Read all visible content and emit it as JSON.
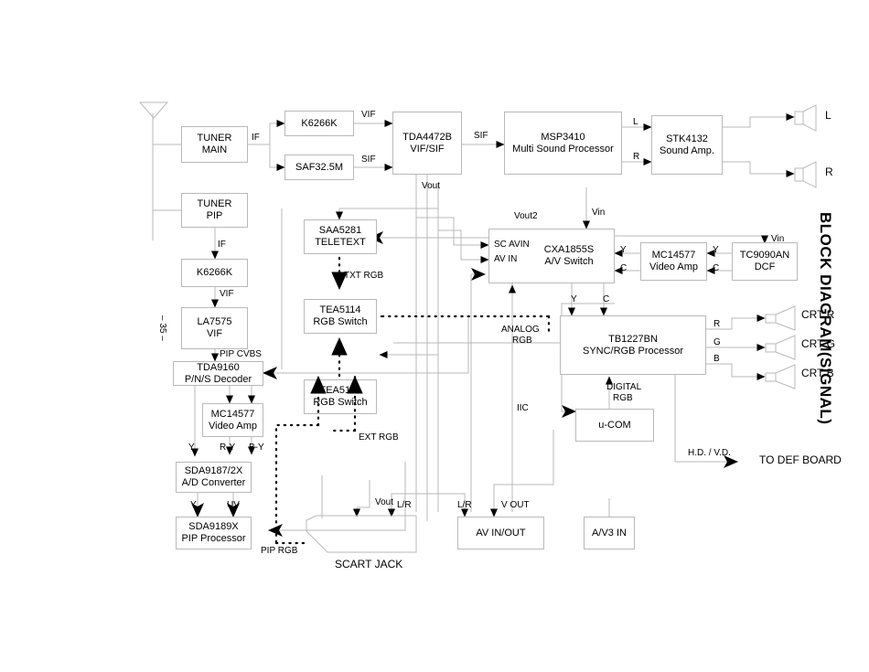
{
  "document": {
    "side_title": "BLOCK DIAGRAM(SIGNAL)",
    "page_number": "– 35 –"
  },
  "blocks": [
    {
      "id": "tuner_main",
      "line1": "TUNER",
      "line2": "MAIN"
    },
    {
      "id": "tuner_pip",
      "line1": "TUNER",
      "line2": "PIP"
    },
    {
      "id": "k6266k_top",
      "line1": "K6266K",
      "line2": ""
    },
    {
      "id": "saf325m",
      "line1": "SAF32.5M",
      "line2": ""
    },
    {
      "id": "tda4472b",
      "line1": "TDA4472B",
      "line2": "VIF/SIF"
    },
    {
      "id": "msp3410",
      "line1": "MSP3410",
      "line2": "Multi Sound Processor"
    },
    {
      "id": "stk4132",
      "line1": "STK4132",
      "line2": "Sound Amp."
    },
    {
      "id": "k6266k_pip",
      "line1": "K6266K",
      "line2": ""
    },
    {
      "id": "la7575",
      "line1": "LA7575",
      "line2": "VIF"
    },
    {
      "id": "tda9160",
      "line1": "TDA9160",
      "line2": "P/N/S Decoder"
    },
    {
      "id": "mc14577_left",
      "line1": "MC14577",
      "line2": "Video Amp"
    },
    {
      "id": "sda9187",
      "line1": "SDA9187/2X",
      "line2": "A/D Converter"
    },
    {
      "id": "sda9189x",
      "line1": "SDA9189X",
      "line2": "PIP Processor"
    },
    {
      "id": "saa5281",
      "line1": "SAA5281",
      "line2": "TELETEXT"
    },
    {
      "id": "tea5114_top",
      "line1": "TEA5114",
      "line2": "RGB Switch"
    },
    {
      "id": "tea5114_bot",
      "line1": "TEA5114",
      "line2": "RGB Switch"
    },
    {
      "id": "cxa1855s",
      "line1": "CXA1855S",
      "line2": "A/V Switch"
    },
    {
      "id": "mc14577_right",
      "line1": "MC14577",
      "line2": "Video Amp"
    },
    {
      "id": "tc9090an",
      "line1": "TC9090AN",
      "line2": "DCF"
    },
    {
      "id": "tb1227bn",
      "line1": "TB1227BN",
      "line2": "SYNC/RGB Processor"
    },
    {
      "id": "ucom",
      "line1": "u-COM",
      "line2": ""
    },
    {
      "id": "av_inout",
      "line1": "AV  IN/OUT",
      "line2": ""
    },
    {
      "id": "av3_in",
      "line1": "A/V3 IN",
      "line2": ""
    }
  ],
  "signal_labels": {
    "if_main": "IF",
    "if_pip": "IF",
    "vif_top": "VIF",
    "sif_top": "SIF",
    "sif_msp": "SIF",
    "vout_tda": "Vout",
    "l_out": "L",
    "r_out": "R",
    "spk_l": "L",
    "spk_r": "R",
    "vif_pip": "VIF",
    "pip_cvbs": "PIP CVBS",
    "y_left": "Y",
    "ry_left": "R-Y",
    "by_left": "B-Y",
    "y_ad": "Y",
    "uv_ad": "UV",
    "txt_rgb": "TXT RGB",
    "ext_rgb": "EXT RGB",
    "pip_rgb": "PIP RGB",
    "analog_rgb_1": "ANALOG",
    "analog_rgb_2": "RGB",
    "digital_rgb_1": "DIGITAL",
    "digital_rgb_2": "RGB",
    "iic": "IIC",
    "vout2": "Vout2",
    "vin_cxa": "Vin",
    "vin_tc": "Vin",
    "sc_avin": "SC  AVIN",
    "av_in": "AV IN",
    "y_cxa_right": "Y",
    "c_cxa_right": "C",
    "y_tc": "Y",
    "c_tc": "C",
    "y_tb": "Y",
    "c_tb": "C",
    "r_tb": "R",
    "g_tb": "G",
    "b_tb": "B",
    "crt_r": "CRT  R",
    "crt_g": "CRT  G",
    "crt_b": "CRT  B",
    "hd_vd": "H.D.  / V.D.",
    "to_def_board": "TO  DEF BOARD",
    "scart_jack": "SCART  JACK",
    "vout_scart": "Vout",
    "lr_scart": "L/R",
    "lr_av": "L/R",
    "v_out_av": "V OUT"
  }
}
